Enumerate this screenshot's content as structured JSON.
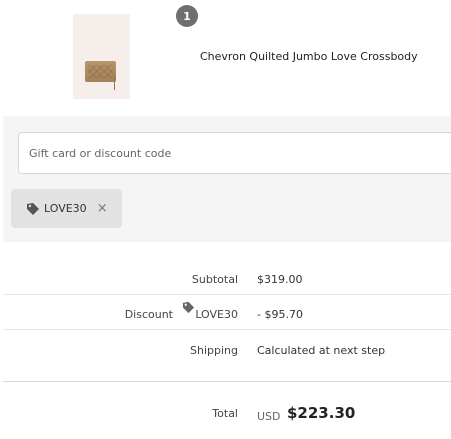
{
  "product": {
    "quantity": "1",
    "name": "Chevron Quilted Jumbo Love Crossbody"
  },
  "discount": {
    "input_placeholder": "Gift card or discount code",
    "applied_code": "LOVE30",
    "remove_icon": "×",
    "tag_icon_name": "tag-icon"
  },
  "summary": {
    "subtotal_label": "Subtotal",
    "subtotal_value": "$319.00",
    "discount_label": "Discount",
    "discount_code": "LOVE30",
    "discount_value": "- $95.70",
    "shipping_label": "Shipping",
    "shipping_value": "Calculated at next step",
    "total_label": "Total",
    "total_currency": "USD",
    "total_value": "$223.30"
  },
  "colors": {
    "badge": "#6f6f6f",
    "panel_background": "#f5f5f5",
    "tag_background": "#e2e2e2"
  }
}
